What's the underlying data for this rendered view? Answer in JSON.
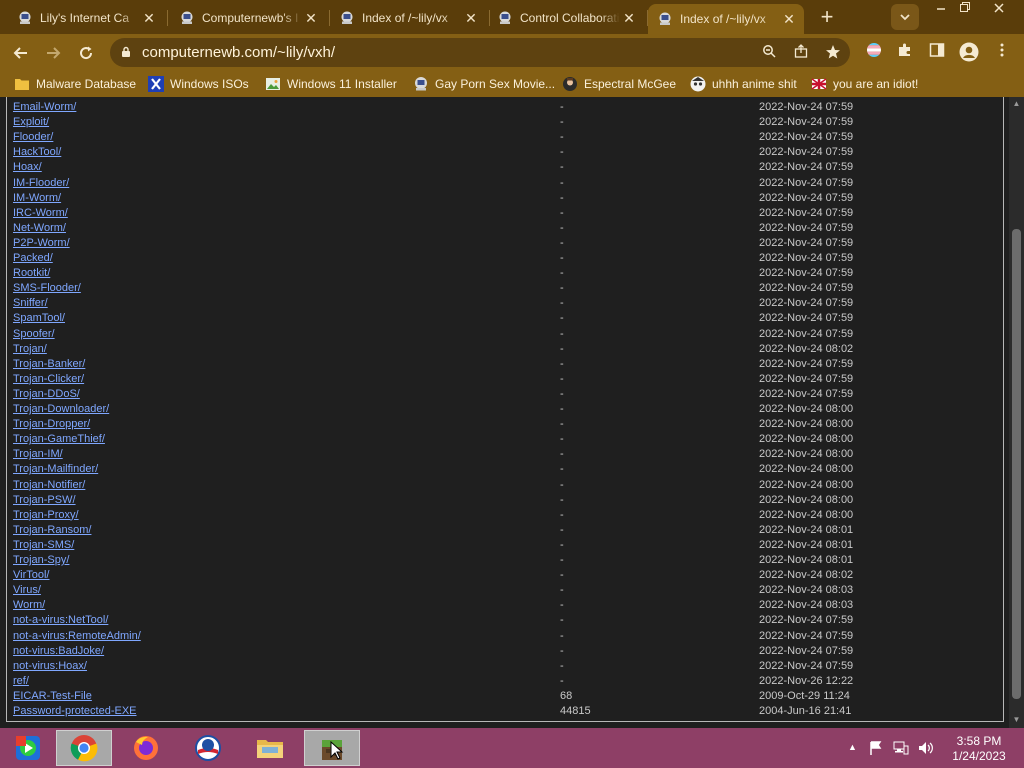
{
  "browser": {
    "tabs": [
      {
        "title": "Lily's Internet Ca",
        "active": false
      },
      {
        "title": "Computernewb's I",
        "active": false
      },
      {
        "title": "Index of /~lily/vx",
        "active": false
      },
      {
        "title": "Control Collaborati",
        "active": false
      },
      {
        "title": "Index of /~lily/vx",
        "active": true
      }
    ],
    "new_tab_label": "+",
    "url": "computernewb.com/~lily/vxh/",
    "bookmarks": [
      {
        "label": "Malware Database",
        "icon": "folder-icon"
      },
      {
        "label": "Windows ISOs",
        "icon": "x-logo-icon"
      },
      {
        "label": "Windows 11 Installer",
        "icon": "image-icon"
      },
      {
        "label": "Gay Porn Sex Movie...",
        "icon": "globe-icon"
      },
      {
        "label": "Espectral McGee",
        "icon": "avatar-icon"
      },
      {
        "label": "uhhh anime shit",
        "icon": "anime-icon"
      },
      {
        "label": "you are an idiot!",
        "icon": "flag-icon"
      }
    ]
  },
  "listing": {
    "rows": [
      {
        "name": "Email-Worm/",
        "size": "-",
        "date": "2022-Nov-24 07:59"
      },
      {
        "name": "Exploit/",
        "size": "-",
        "date": "2022-Nov-24 07:59"
      },
      {
        "name": "Flooder/",
        "size": "-",
        "date": "2022-Nov-24 07:59"
      },
      {
        "name": "HackTool/",
        "size": "-",
        "date": "2022-Nov-24 07:59"
      },
      {
        "name": "Hoax/",
        "size": "-",
        "date": "2022-Nov-24 07:59"
      },
      {
        "name": "IM-Flooder/",
        "size": "-",
        "date": "2022-Nov-24 07:59"
      },
      {
        "name": "IM-Worm/",
        "size": "-",
        "date": "2022-Nov-24 07:59"
      },
      {
        "name": "IRC-Worm/",
        "size": "-",
        "date": "2022-Nov-24 07:59"
      },
      {
        "name": "Net-Worm/",
        "size": "-",
        "date": "2022-Nov-24 07:59"
      },
      {
        "name": "P2P-Worm/",
        "size": "-",
        "date": "2022-Nov-24 07:59"
      },
      {
        "name": "Packed/",
        "size": "-",
        "date": "2022-Nov-24 07:59"
      },
      {
        "name": "Rootkit/",
        "size": "-",
        "date": "2022-Nov-24 07:59"
      },
      {
        "name": "SMS-Flooder/",
        "size": "-",
        "date": "2022-Nov-24 07:59"
      },
      {
        "name": "Sniffer/",
        "size": "-",
        "date": "2022-Nov-24 07:59"
      },
      {
        "name": "SpamTool/",
        "size": "-",
        "date": "2022-Nov-24 07:59"
      },
      {
        "name": "Spoofer/",
        "size": "-",
        "date": "2022-Nov-24 07:59"
      },
      {
        "name": "Trojan/",
        "size": "-",
        "date": "2022-Nov-24 08:02"
      },
      {
        "name": "Trojan-Banker/",
        "size": "-",
        "date": "2022-Nov-24 07:59"
      },
      {
        "name": "Trojan-Clicker/",
        "size": "-",
        "date": "2022-Nov-24 07:59"
      },
      {
        "name": "Trojan-DDoS/",
        "size": "-",
        "date": "2022-Nov-24 07:59"
      },
      {
        "name": "Trojan-Downloader/",
        "size": "-",
        "date": "2022-Nov-24 08:00"
      },
      {
        "name": "Trojan-Dropper/",
        "size": "-",
        "date": "2022-Nov-24 08:00"
      },
      {
        "name": "Trojan-GameThief/",
        "size": "-",
        "date": "2022-Nov-24 08:00"
      },
      {
        "name": "Trojan-IM/",
        "size": "-",
        "date": "2022-Nov-24 08:00"
      },
      {
        "name": "Trojan-Mailfinder/",
        "size": "-",
        "date": "2022-Nov-24 08:00"
      },
      {
        "name": "Trojan-Notifier/",
        "size": "-",
        "date": "2022-Nov-24 08:00"
      },
      {
        "name": "Trojan-PSW/",
        "size": "-",
        "date": "2022-Nov-24 08:00"
      },
      {
        "name": "Trojan-Proxy/",
        "size": "-",
        "date": "2022-Nov-24 08:00"
      },
      {
        "name": "Trojan-Ransom/",
        "size": "-",
        "date": "2022-Nov-24 08:01"
      },
      {
        "name": "Trojan-SMS/",
        "size": "-",
        "date": "2022-Nov-24 08:01"
      },
      {
        "name": "Trojan-Spy/",
        "size": "-",
        "date": "2022-Nov-24 08:01"
      },
      {
        "name": "VirTool/",
        "size": "-",
        "date": "2022-Nov-24 08:02"
      },
      {
        "name": "Virus/",
        "size": "-",
        "date": "2022-Nov-24 08:03"
      },
      {
        "name": "Worm/",
        "size": "-",
        "date": "2022-Nov-24 08:03"
      },
      {
        "name": "not-a-virus:NetTool/",
        "size": "-",
        "date": "2022-Nov-24 07:59"
      },
      {
        "name": "not-a-virus:RemoteAdmin/",
        "size": "-",
        "date": "2022-Nov-24 07:59"
      },
      {
        "name": "not-virus:BadJoke/",
        "size": "-",
        "date": "2022-Nov-24 07:59"
      },
      {
        "name": "not-virus:Hoax/",
        "size": "-",
        "date": "2022-Nov-24 07:59"
      },
      {
        "name": "ref/",
        "size": "-",
        "date": "2022-Nov-26 12:22"
      },
      {
        "name": "EICAR-Test-File",
        "size": "68",
        "date": "2009-Oct-29 11:24"
      },
      {
        "name": "Password-protected-EXE",
        "size": "44815",
        "date": "2004-Jun-16 21:41"
      }
    ]
  },
  "taskbar": {
    "apps": [
      {
        "name": "windows-media-center",
        "icon": "media-center-icon",
        "active": false
      },
      {
        "name": "chrome",
        "icon": "chrome-icon",
        "active": true
      },
      {
        "name": "firefox",
        "icon": "firefox-icon",
        "active": false
      },
      {
        "name": "obama",
        "icon": "obama-logo-icon",
        "active": false
      },
      {
        "name": "file-explorer",
        "icon": "folder-icon",
        "active": false
      },
      {
        "name": "minecraft",
        "icon": "minecraft-icon",
        "active": true
      }
    ],
    "clock_time": "3:58 PM",
    "clock_date": "1/24/2023"
  },
  "colors": {
    "tabstrip": "#5a3d0a",
    "toolbar": "#845f14",
    "link": "#7fa7ff",
    "taskbar": "#8e3f66"
  }
}
